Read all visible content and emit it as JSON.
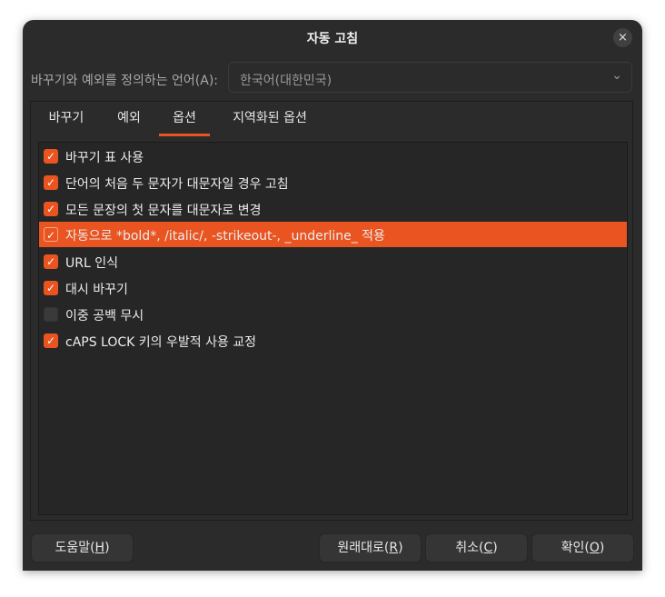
{
  "dialog": {
    "title": "자동 고침",
    "close_icon": "×"
  },
  "language": {
    "label": "바꾸기와 예외를 정의하는 언어(A):",
    "selected": "한국어(대한민국)",
    "chevron": "⌄"
  },
  "tabs": [
    {
      "label": "바꾸기"
    },
    {
      "label": "예외"
    },
    {
      "label": "옵션",
      "active": true
    },
    {
      "label": "지역화된 옵션"
    }
  ],
  "options": [
    {
      "label": "바꾸기 표 사용",
      "checked": true
    },
    {
      "label": "단어의 처음 두 문자가 대문자일 경우 고침",
      "checked": true
    },
    {
      "label": "모든 문장의 첫 문자를 대문자로 변경",
      "checked": true
    },
    {
      "label": "자동으로 *bold*, /italic/, -strikeout-, _underline_ 적용",
      "checked": true,
      "selected": true
    },
    {
      "label": "URL 인식",
      "checked": true
    },
    {
      "label": "대시 바꾸기",
      "checked": true
    },
    {
      "label": "이중 공백 무시",
      "checked": false
    },
    {
      "label": "cAPS LOCK 키의 우발적 사용 교정",
      "checked": true
    }
  ],
  "check_glyph": "✓",
  "buttons": {
    "help": {
      "pre": "도움말(",
      "key": "H",
      "post": ")"
    },
    "reset": {
      "pre": "원래대로(",
      "key": "R",
      "post": ")"
    },
    "cancel": {
      "pre": "취소(",
      "key": "C",
      "post": ")"
    },
    "ok": {
      "pre": "확인(",
      "key": "O",
      "post": ")"
    }
  },
  "colors": {
    "accent": "#e95420",
    "background": "#2b2b2b"
  }
}
